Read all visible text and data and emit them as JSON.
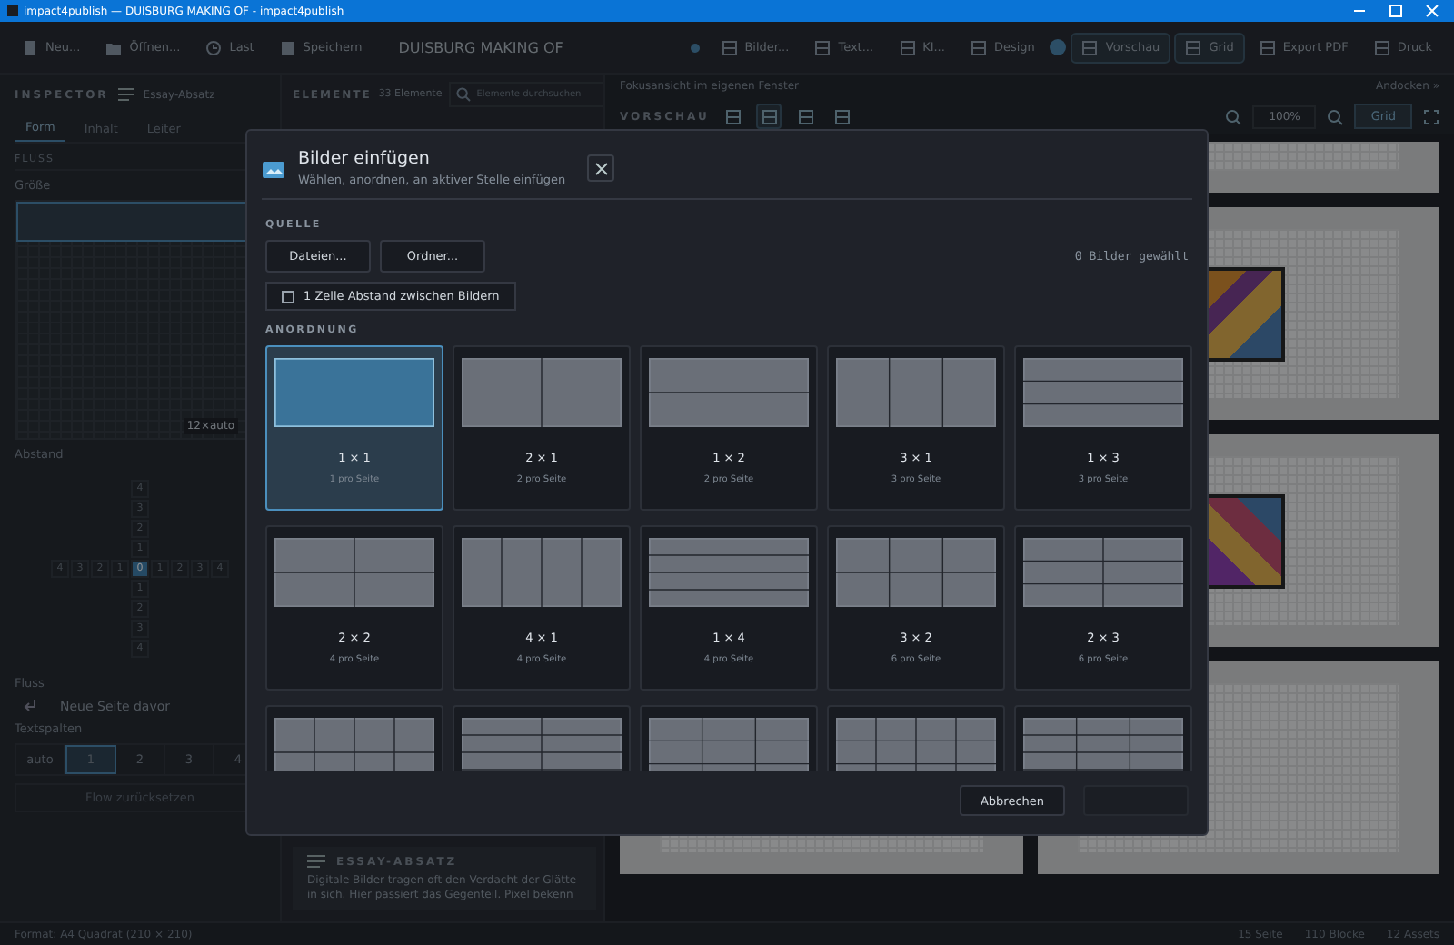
{
  "window": {
    "title": "impact4publish — DUISBURG MAKING OF - impact4publish"
  },
  "toolbar": {
    "left": [
      "Neu...",
      "Öffnen...",
      "Last",
      "Speichern"
    ],
    "document_title": "DUISBURG MAKING OF",
    "right": [
      {
        "label": "Bilder...",
        "selected": false
      },
      {
        "label": "Text...",
        "selected": false
      },
      {
        "label": "KI...",
        "selected": false
      },
      {
        "label": "Design",
        "selected": false
      },
      {
        "label": "Vorschau",
        "selected": true
      },
      {
        "label": "Grid",
        "selected": true
      },
      {
        "label": "Export PDF",
        "selected": false
      },
      {
        "label": "Druck",
        "selected": false
      }
    ]
  },
  "inspector": {
    "title": "INSPECTOR",
    "subtitle": "Essay-Absatz",
    "tabs": [
      {
        "label": "Form",
        "selected": true
      },
      {
        "label": "Inhalt",
        "selected": false
      },
      {
        "label": "Leiter",
        "selected": false
      }
    ],
    "section": "FLUSS",
    "size_label": "Größe",
    "size_badge": "12×auto",
    "spacing_label": "Abstand",
    "spacing_top": [
      {
        "label": "4",
        "selected": false
      },
      {
        "label": "3",
        "selected": false
      },
      {
        "label": "2",
        "selected": false
      },
      {
        "label": "1",
        "selected": false
      }
    ],
    "spacing_left": [
      {
        "label": "4",
        "selected": false
      },
      {
        "label": "3",
        "selected": false
      },
      {
        "label": "2",
        "selected": false
      },
      {
        "label": "1",
        "selected": false
      }
    ],
    "spacing_center": {
      "label": "0",
      "selected": true
    },
    "spacing_right": [
      {
        "label": "1",
        "selected": false
      },
      {
        "label": "2",
        "selected": false
      },
      {
        "label": "3",
        "selected": false
      },
      {
        "label": "4",
        "selected": false
      }
    ],
    "spacing_bottom": [
      {
        "label": "1",
        "selected": false
      },
      {
        "label": "2",
        "selected": false
      },
      {
        "label": "3",
        "selected": false
      },
      {
        "label": "4",
        "selected": false
      }
    ],
    "flow_label": "Fluss",
    "flow_option": "Neue Seite davor",
    "columns_label": "Textspalten",
    "columns": [
      {
        "label": "auto",
        "selected": false
      },
      {
        "label": "1",
        "selected": true
      },
      {
        "label": "2",
        "selected": false
      },
      {
        "label": "3",
        "selected": false
      },
      {
        "label": "4",
        "selected": false
      }
    ],
    "reset_button": "Flow zurücksetzen"
  },
  "elements": {
    "title": "ELEMENTE",
    "count": "33 Elemente",
    "search": {
      "placeholder": "Elemente durchsuchen"
    },
    "card": {
      "title": "ESSAY-ABSATZ",
      "text": "Digitale Bilder tragen oft den Verdacht der Glätte in sich. Hier passiert das Gegenteil. Pixel bekenn"
    }
  },
  "preview": {
    "hint": "Fokusansicht im eigenen Fenster",
    "title": "VORSCHAU",
    "dock": "Andocken »",
    "zoom": "100%",
    "grid_button": {
      "label": "Grid",
      "selected": true
    },
    "view_modes": [
      {
        "selected": false
      },
      {
        "selected": true
      },
      {
        "selected": false
      },
      {
        "selected": false
      }
    ]
  },
  "dialog": {
    "title": "Bilder einfügen",
    "subtitle": "Wählen, anordnen, an aktiver Stelle einfügen",
    "source_label": "QUELLE",
    "source_buttons": [
      "Dateien...",
      "Ordner..."
    ],
    "selection_count": "0 Bilder gewählt",
    "spacing_option": {
      "label": "1 Zelle Abstand zwischen Bildern",
      "checked": false
    },
    "layout_label": "ANORDNUNG",
    "layouts": [
      {
        "kind": "single",
        "label": "1 × 1",
        "caption": "1 pro Seite",
        "selected": true
      },
      {
        "kind": "twocols",
        "label": "2 × 1",
        "caption": "2 pro Seite",
        "selected": false
      },
      {
        "kind": "tworows",
        "label": "1 × 2",
        "caption": "2 pro Seite",
        "selected": false
      },
      {
        "kind": "threecols",
        "label": "3 × 1",
        "caption": "3 pro Seite",
        "selected": false
      },
      {
        "kind": "threerows",
        "label": "1 × 3",
        "caption": "3 pro Seite",
        "selected": false
      },
      {
        "kind": "quad",
        "label": "2 × 2",
        "caption": "4 pro Seite",
        "selected": false
      },
      {
        "kind": "fourcols",
        "label": "4 × 1",
        "caption": "4 pro Seite",
        "selected": false
      },
      {
        "kind": "fourrows",
        "label": "1 × 4",
        "caption": "4 pro Seite",
        "selected": false
      },
      {
        "kind": "sixwide",
        "label": "3 × 2",
        "caption": "6 pro Seite",
        "selected": false
      },
      {
        "kind": "sixtall",
        "label": "2 × 3",
        "caption": "6 pro Seite",
        "selected": false
      },
      {
        "kind": "eightwide",
        "selected": false
      },
      {
        "kind": "eighttall",
        "selected": false
      },
      {
        "kind": "nine",
        "selected": false
      },
      {
        "kind": "twelvewide",
        "selected": false
      },
      {
        "kind": "twelvetall",
        "selected": false
      }
    ],
    "cancel_button": "Abbrechen",
    "insert_disabled": true
  },
  "status_bar": {
    "left": "Format: A4 Quadrat (210 × 210)",
    "stats": [
      "15 Seite",
      "110 Blöcke",
      "12 Assets"
    ]
  }
}
